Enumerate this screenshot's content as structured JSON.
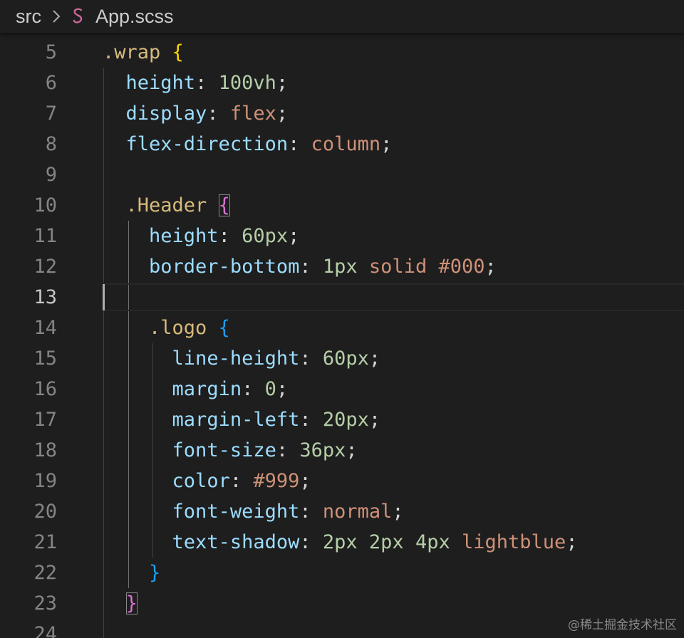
{
  "breadcrumb": {
    "folder": "src",
    "file": "App.scss",
    "separator_icon": "chevron-right-icon",
    "file_icon": "sass-file-icon",
    "file_icon_color": "#cd6799"
  },
  "editor": {
    "active_line": 13,
    "lines": [
      {
        "n": "5",
        "tokens": [
          {
            "t": ".wrap",
            "k": "sel"
          },
          {
            "t": " ",
            "k": "punc"
          },
          {
            "t": "{",
            "k": "b1"
          }
        ]
      },
      {
        "n": "6",
        "tokens": [
          {
            "t": "  ",
            "k": "punc"
          },
          {
            "t": "height",
            "k": "prop"
          },
          {
            "t": ": ",
            "k": "punc"
          },
          {
            "t": "100vh",
            "k": "num"
          },
          {
            "t": ";",
            "k": "punc"
          }
        ]
      },
      {
        "n": "7",
        "tokens": [
          {
            "t": "  ",
            "k": "punc"
          },
          {
            "t": "display",
            "k": "prop"
          },
          {
            "t": ": ",
            "k": "punc"
          },
          {
            "t": "flex",
            "k": "val"
          },
          {
            "t": ";",
            "k": "punc"
          }
        ]
      },
      {
        "n": "8",
        "tokens": [
          {
            "t": "  ",
            "k": "punc"
          },
          {
            "t": "flex-direction",
            "k": "prop"
          },
          {
            "t": ": ",
            "k": "punc"
          },
          {
            "t": "column",
            "k": "val"
          },
          {
            "t": ";",
            "k": "punc"
          }
        ]
      },
      {
        "n": "9",
        "tokens": []
      },
      {
        "n": "10",
        "tokens": [
          {
            "t": "  ",
            "k": "punc"
          },
          {
            "t": ".Header",
            "k": "sel"
          },
          {
            "t": " ",
            "k": "punc"
          },
          {
            "t": "{",
            "k": "b2",
            "box": true
          }
        ]
      },
      {
        "n": "11",
        "tokens": [
          {
            "t": "    ",
            "k": "punc"
          },
          {
            "t": "height",
            "k": "prop"
          },
          {
            "t": ": ",
            "k": "punc"
          },
          {
            "t": "60px",
            "k": "num"
          },
          {
            "t": ";",
            "k": "punc"
          }
        ]
      },
      {
        "n": "12",
        "tokens": [
          {
            "t": "    ",
            "k": "punc"
          },
          {
            "t": "border-bottom",
            "k": "prop"
          },
          {
            "t": ": ",
            "k": "punc"
          },
          {
            "t": "1px",
            "k": "num"
          },
          {
            "t": " ",
            "k": "punc"
          },
          {
            "t": "solid",
            "k": "val"
          },
          {
            "t": " ",
            "k": "punc"
          },
          {
            "t": "#000",
            "k": "val"
          },
          {
            "t": ";",
            "k": "punc"
          }
        ]
      },
      {
        "n": "13",
        "tokens": []
      },
      {
        "n": "14",
        "tokens": [
          {
            "t": "    ",
            "k": "punc"
          },
          {
            "t": ".logo",
            "k": "sel"
          },
          {
            "t": " ",
            "k": "punc"
          },
          {
            "t": "{",
            "k": "b3"
          }
        ]
      },
      {
        "n": "15",
        "tokens": [
          {
            "t": "      ",
            "k": "punc"
          },
          {
            "t": "line-height",
            "k": "prop"
          },
          {
            "t": ": ",
            "k": "punc"
          },
          {
            "t": "60px",
            "k": "num"
          },
          {
            "t": ";",
            "k": "punc"
          }
        ]
      },
      {
        "n": "16",
        "tokens": [
          {
            "t": "      ",
            "k": "punc"
          },
          {
            "t": "margin",
            "k": "prop"
          },
          {
            "t": ": ",
            "k": "punc"
          },
          {
            "t": "0",
            "k": "num"
          },
          {
            "t": ";",
            "k": "punc"
          }
        ]
      },
      {
        "n": "17",
        "tokens": [
          {
            "t": "      ",
            "k": "punc"
          },
          {
            "t": "margin-left",
            "k": "prop"
          },
          {
            "t": ": ",
            "k": "punc"
          },
          {
            "t": "20px",
            "k": "num"
          },
          {
            "t": ";",
            "k": "punc"
          }
        ]
      },
      {
        "n": "18",
        "tokens": [
          {
            "t": "      ",
            "k": "punc"
          },
          {
            "t": "font-size",
            "k": "prop"
          },
          {
            "t": ": ",
            "k": "punc"
          },
          {
            "t": "36px",
            "k": "num"
          },
          {
            "t": ";",
            "k": "punc"
          }
        ]
      },
      {
        "n": "19",
        "tokens": [
          {
            "t": "      ",
            "k": "punc"
          },
          {
            "t": "color",
            "k": "prop"
          },
          {
            "t": ": ",
            "k": "punc"
          },
          {
            "t": "#999",
            "k": "val"
          },
          {
            "t": ";",
            "k": "punc"
          }
        ]
      },
      {
        "n": "20",
        "tokens": [
          {
            "t": "      ",
            "k": "punc"
          },
          {
            "t": "font-weight",
            "k": "prop"
          },
          {
            "t": ": ",
            "k": "punc"
          },
          {
            "t": "normal",
            "k": "val"
          },
          {
            "t": ";",
            "k": "punc"
          }
        ]
      },
      {
        "n": "21",
        "tokens": [
          {
            "t": "      ",
            "k": "punc"
          },
          {
            "t": "text-shadow",
            "k": "prop"
          },
          {
            "t": ": ",
            "k": "punc"
          },
          {
            "t": "2px",
            "k": "num"
          },
          {
            "t": " ",
            "k": "punc"
          },
          {
            "t": "2px",
            "k": "num"
          },
          {
            "t": " ",
            "k": "punc"
          },
          {
            "t": "4px",
            "k": "num"
          },
          {
            "t": " ",
            "k": "punc"
          },
          {
            "t": "lightblue",
            "k": "val"
          },
          {
            "t": ";",
            "k": "punc"
          }
        ]
      },
      {
        "n": "22",
        "tokens": [
          {
            "t": "    ",
            "k": "punc"
          },
          {
            "t": "}",
            "k": "b3"
          }
        ]
      },
      {
        "n": "23",
        "tokens": [
          {
            "t": "  ",
            "k": "punc"
          },
          {
            "t": "}",
            "k": "b2",
            "box": true
          }
        ]
      },
      {
        "n": "24",
        "tokens": []
      }
    ]
  },
  "colors": {
    "background": "#1e1e1e",
    "selector": "#d7ba7d",
    "property": "#9cdcfe",
    "number": "#b5cea8",
    "string_value": "#ce9178",
    "bracket_level1": "#ffd700",
    "bracket_level2": "#da70d6",
    "bracket_level3": "#179fff"
  },
  "watermark": "@稀土掘金技术社区"
}
